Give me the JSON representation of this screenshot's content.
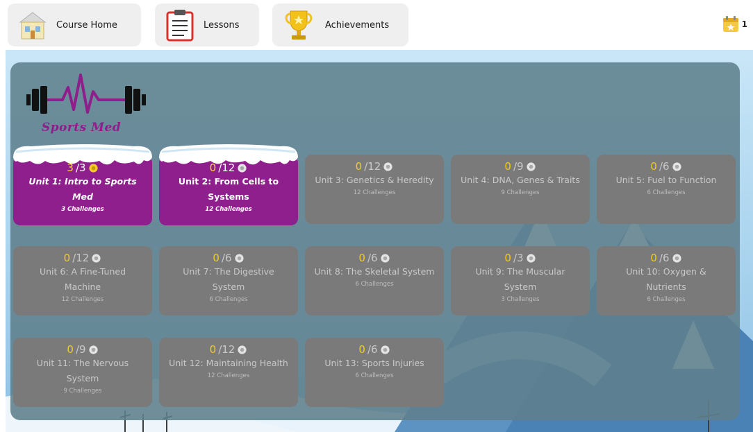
{
  "nav": {
    "course_home": "Course Home",
    "lessons": "Lessons",
    "achievements": "Achievements",
    "streak_count": "1"
  },
  "logo": {
    "text": "Sports Med"
  },
  "units": [
    {
      "done": "3",
      "total": "/3",
      "title": "Unit 1: Intro to Sports Med",
      "challenges": "3 Challenges",
      "active": true
    },
    {
      "done": "0",
      "total": "/12",
      "title": "Unit 2: From Cells to Systems",
      "challenges": "12 Challenges",
      "active": true
    },
    {
      "done": "0",
      "total": "/12",
      "title": "Unit 3: Genetics & Heredity",
      "challenges": "12 Challenges",
      "active": false
    },
    {
      "done": "0",
      "total": "/9",
      "title": "Unit 4: DNA, Genes & Traits",
      "challenges": "9 Challenges",
      "active": false
    },
    {
      "done": "0",
      "total": "/6",
      "title": "Unit 5: Fuel to Function",
      "challenges": "6 Challenges",
      "active": false
    },
    {
      "done": "0",
      "total": "/12",
      "title": "Unit 6: A Fine-Tuned Machine",
      "challenges": "12 Challenges",
      "active": false
    },
    {
      "done": "0",
      "total": "/6",
      "title": "Unit 7: The Digestive System",
      "challenges": "6 Challenges",
      "active": false
    },
    {
      "done": "0",
      "total": "/6",
      "title": "Unit 8: The Skeletal System",
      "challenges": "6 Challenges",
      "active": false
    },
    {
      "done": "0",
      "total": "/3",
      "title": "Unit 9: The Muscular System",
      "challenges": "3 Challenges",
      "active": false
    },
    {
      "done": "0",
      "total": "/6",
      "title": "Unit 10: Oxygen & Nutrients",
      "challenges": "6 Challenges",
      "active": false
    },
    {
      "done": "0",
      "total": "/9",
      "title": "Unit 11: The Nervous System",
      "challenges": "9 Challenges",
      "active": false
    },
    {
      "done": "0",
      "total": "/12",
      "title": "Unit 12: Maintaining Health",
      "challenges": "12 Challenges",
      "active": false
    },
    {
      "done": "0",
      "total": "/6",
      "title": "Unit 13: Sports Injuries",
      "challenges": "6 Challenges",
      "active": false
    }
  ],
  "colors": {
    "active_card": "#8f1f8c",
    "inactive_card": "#7a7a7a",
    "panel": "#5f808c",
    "done_accent": "#f3cc28"
  }
}
